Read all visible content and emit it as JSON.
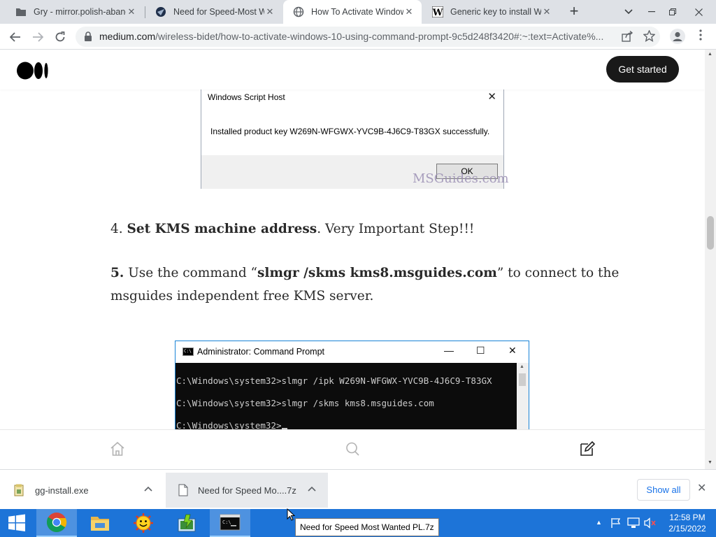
{
  "browser": {
    "tabs": [
      {
        "title": "Gry - mirror.polish-aband",
        "icon": "folder-icon"
      },
      {
        "title": "Need for Speed-Most Wa",
        "icon": "nfs-icon"
      },
      {
        "title": "How To Activate Window",
        "icon": "globe-icon",
        "active": true
      },
      {
        "title": "Generic key to install Wi",
        "icon": "wikipedia-icon"
      }
    ],
    "close_glyph": "✕",
    "new_tab": "+",
    "url_host": "medium.com",
    "url_path": "/wireless-bidet/how-to-activate-windows-10-using-command-prompt-9c5d248f3420#:~:text=Activate%..."
  },
  "medium": {
    "get_started": "Get started"
  },
  "wsh_dialog": {
    "title": "Windows Script Host",
    "message": "Installed product key W269N-WFGWX-YVC9B-4J6C9-T83GX successfully.",
    "ok_label": "OK",
    "watermark": "MSGuides.com"
  },
  "article": {
    "step4_num": "4. ",
    "step4_bold": "Set KMS machine address",
    "step4_rest": ". Very Important Step!!!",
    "step5_num": "5.",
    "step5_pre": " Use the command “",
    "step5_bold": "slmgr /skms kms8.msguides.com",
    "step5_post": "” to connect to the",
    "step5_line2": "msguides independent free KMS server."
  },
  "cmd_window": {
    "title": "Administrator: Command Prompt",
    "lines": [
      "C:\\Windows\\system32>slmgr /ipk W269N-WFGWX-YVC9B-4J6C9-T83GX",
      "C:\\Windows\\system32>slmgr /skms kms8.msguides.com",
      "C:\\Windows\\system32>"
    ]
  },
  "downloads": {
    "items": [
      {
        "name": "gg-install.exe"
      },
      {
        "name": "Need for Speed Mo....7z"
      }
    ],
    "show_all": "Show all"
  },
  "taskbar": {
    "time": "12:58 PM",
    "date": "2/15/2022",
    "tooltip": "Need for Speed Most Wanted PL.7z"
  },
  "colors": {
    "taskbar": "#1d74d8",
    "tabstrip": "#dee1e6",
    "medium_button": "#191919",
    "link_blue": "#1a73e8"
  }
}
